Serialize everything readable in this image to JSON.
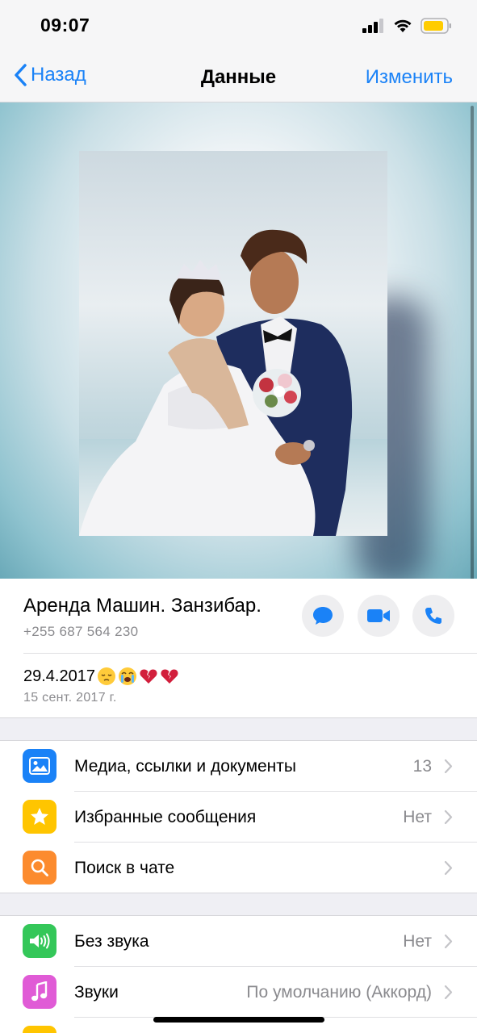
{
  "status": {
    "time": "09:07"
  },
  "nav": {
    "back_label": "Назад",
    "title": "Данные",
    "edit_label": "Изменить"
  },
  "contact": {
    "name": "Аренда Машин. Занзибар.",
    "phone": "+255 687 564 230"
  },
  "actions": {
    "message_icon": "message-icon",
    "video_icon": "video-call-icon",
    "call_icon": "phone-call-icon"
  },
  "about": {
    "text": "29.4.2017",
    "emojis": [
      "pensive",
      "loudly-crying",
      "broken-heart",
      "broken-heart"
    ],
    "date": "15 сент. 2017 г."
  },
  "menu1": [
    {
      "label": "Медиа, ссылки и документы",
      "value": "13",
      "icon": "photo-icon",
      "color": "#1a82f7"
    },
    {
      "label": "Избранные сообщения",
      "value": "Нет",
      "icon": "star-icon",
      "color": "#ffc500"
    },
    {
      "label": "Поиск в чате",
      "value": "",
      "icon": "search-icon",
      "color": "#fc8b2e"
    }
  ],
  "menu2": [
    {
      "label": "Без звука",
      "value": "Нет",
      "icon": "speaker-icon",
      "color": "#34c759"
    },
    {
      "label": "Звуки",
      "value": "По умолчанию (Аккорд)",
      "icon": "music-note-icon",
      "color": "#e05bd6"
    }
  ],
  "colors": {
    "accent": "#1a82f7",
    "secondary_text": "#8a8a8e",
    "group_bg": "#efeff4"
  }
}
